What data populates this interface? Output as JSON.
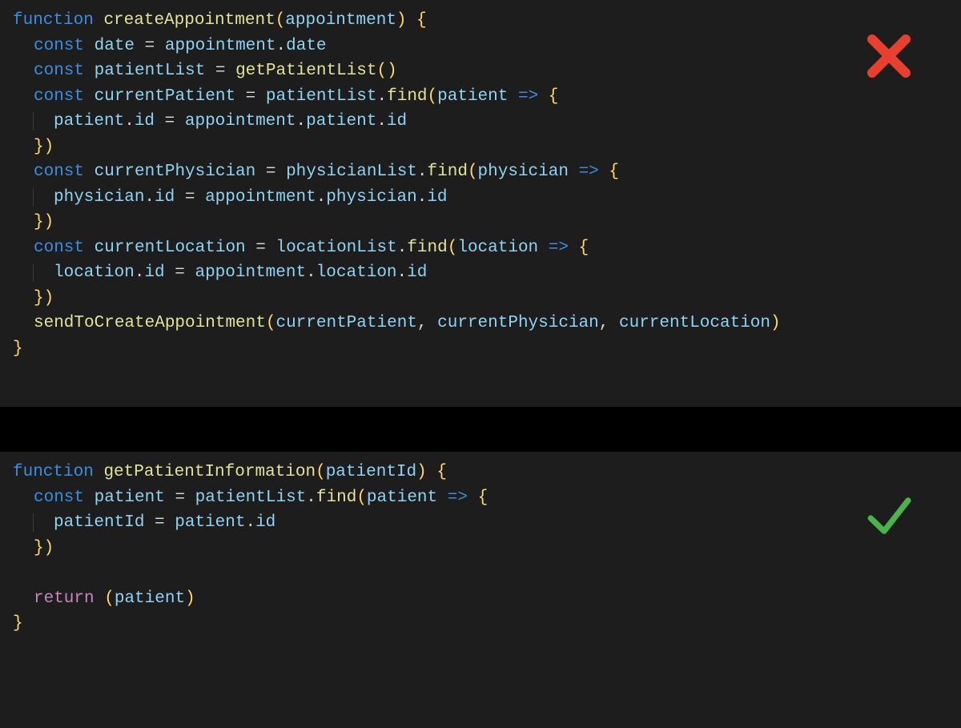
{
  "colors": {
    "keyword": "#3a8de0",
    "function": "#e2e29a",
    "variable": "#8fd3f4",
    "operator": "#d4d4d4",
    "brace": "#ffd866",
    "background": "#1d1d1d",
    "x_icon": "#e8402f",
    "check_icon": "#4bb34b"
  },
  "top": {
    "l1_function": "function",
    "l1_name": "createAppointment",
    "l1_p1": "(",
    "l1_param": "appointment",
    "l1_p2": ")",
    "l1_space": " ",
    "l1_brace": "{",
    "l2_const": "const",
    "l2_var": "date",
    "l2_eq": " = ",
    "l2_obj": "appointment",
    "l2_dot": ".",
    "l2_prop": "date",
    "l3_const": "const",
    "l3_var": "patientList",
    "l3_eq": " = ",
    "l3_call": "getPatientList",
    "l3_p": "()",
    "l4_const": "const",
    "l4_var": "currentPatient",
    "l4_eq": " = ",
    "l4_obj": "patientList",
    "l4_dot": ".",
    "l4_fn": "find",
    "l4_p1": "(",
    "l4_param": "patient",
    "l4_arrow": " => ",
    "l4_brace": "{",
    "l5_obj": "patient",
    "l5_dot": ".",
    "l5_prop": "id",
    "l5_eq": " = ",
    "l5_obj2": "appointment",
    "l5_dot2": ".",
    "l5_prop2": "patient",
    "l5_dot3": ".",
    "l5_prop3": "id",
    "l6_brace": "}",
    "l6_p": ")",
    "l7_const": "const",
    "l7_var": "currentPhysician",
    "l7_eq": " = ",
    "l7_obj": "physicianList",
    "l7_dot": ".",
    "l7_fn": "find",
    "l7_p1": "(",
    "l7_param": "physician",
    "l7_arrow": " => ",
    "l7_brace": "{",
    "l8_obj": "physician",
    "l8_dot": ".",
    "l8_prop": "id",
    "l8_eq": " = ",
    "l8_obj2": "appointment",
    "l8_dot2": ".",
    "l8_prop2": "physician",
    "l8_dot3": ".",
    "l8_prop3": "id",
    "l9_brace": "}",
    "l9_p": ")",
    "l10_const": "const",
    "l10_var": "currentLocation",
    "l10_eq": " = ",
    "l10_obj": "locationList",
    "l10_dot": ".",
    "l10_fn": "find",
    "l10_p1": "(",
    "l10_param": "location",
    "l10_arrow": " => ",
    "l10_brace": "{",
    "l11_obj": "location",
    "l11_dot": ".",
    "l11_prop": "id",
    "l11_eq": " = ",
    "l11_obj2": "appointment",
    "l11_dot2": ".",
    "l11_prop2": "location",
    "l11_dot3": ".",
    "l11_prop3": "id",
    "l12_brace": "}",
    "l12_p": ")",
    "l13_fn": "sendToCreateAppointment",
    "l13_p1": "(",
    "l13_a1": "currentPatient",
    "l13_c1": ", ",
    "l13_a2": "currentPhysician",
    "l13_c2": ", ",
    "l13_a3": "currentLocation",
    "l13_p2": ")",
    "l14_brace": "}"
  },
  "bottom": {
    "l1_function": "function",
    "l1_name": "getPatientInformation",
    "l1_p1": "(",
    "l1_param": "patientId",
    "l1_p2": ")",
    "l1_space": " ",
    "l1_brace": "{",
    "l2_const": "const",
    "l2_var": "patient",
    "l2_eq": " = ",
    "l2_obj": "patientList",
    "l2_dot": ".",
    "l2_fn": "find",
    "l2_p1": "(",
    "l2_param": "patient",
    "l2_arrow": " => ",
    "l2_brace": "{",
    "l3_lhs": "patientId",
    "l3_eq": " = ",
    "l3_obj": "patient",
    "l3_dot": ".",
    "l3_prop": "id",
    "l4_brace": "}",
    "l4_p": ")",
    "l5_blank": " ",
    "l6_return": "return",
    "l6_sp": " ",
    "l6_p1": "(",
    "l6_var": "patient",
    "l6_p2": ")",
    "l7_brace": "}"
  },
  "icons": {
    "x": "cross-icon",
    "check": "check-icon"
  }
}
